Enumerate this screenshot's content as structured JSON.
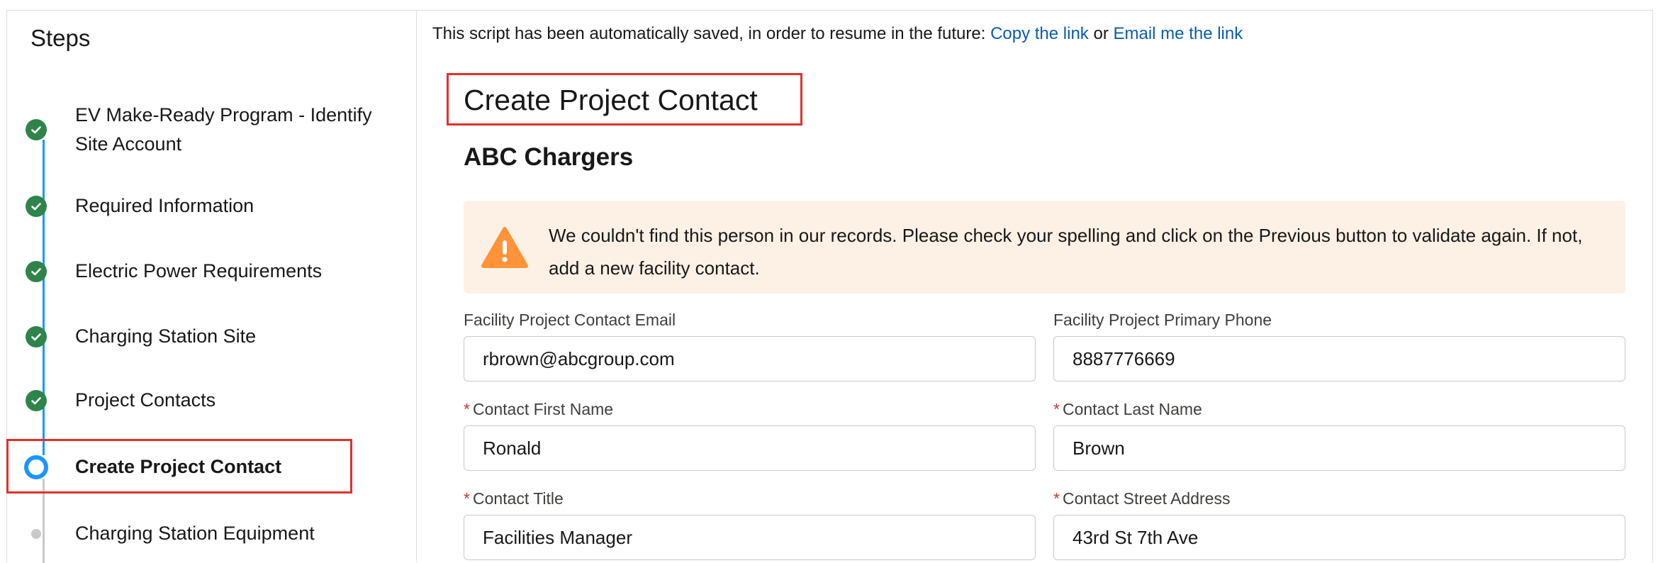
{
  "sidebar": {
    "title": "Steps",
    "steps": [
      {
        "label": "EV Make-Ready Program - Identify Site Account",
        "status": "complete"
      },
      {
        "label": "Required Information",
        "status": "complete"
      },
      {
        "label": "Electric Power Requirements",
        "status": "complete"
      },
      {
        "label": "Charging Station Site",
        "status": "complete"
      },
      {
        "label": "Project Contacts",
        "status": "complete"
      },
      {
        "label": "Create Project Contact",
        "status": "current"
      },
      {
        "label": "Charging Station Equipment",
        "status": "upcoming"
      }
    ]
  },
  "autosave": {
    "message": "This script has been automatically saved, in order to resume in the future: ",
    "copy_link": "Copy the link",
    "separator": " or ",
    "email_link": "Email me the link"
  },
  "form": {
    "title": "Create Project Contact",
    "org_name": "ABC Chargers",
    "warning": "We couldn't find this person in our records. Please check your spelling and click on the Previous button to validate again. If not, add a new facility contact.",
    "fields": {
      "email": {
        "label": "Facility Project Contact Email",
        "value": "rbrown@abcgroup.com",
        "required": false
      },
      "phone": {
        "label": "Facility Project Primary Phone",
        "value": "8887776669",
        "required": false
      },
      "first_name": {
        "label": "Contact First Name",
        "value": "Ronald",
        "required": true
      },
      "last_name": {
        "label": "Contact Last Name",
        "value": "Brown",
        "required": true
      },
      "title": {
        "label": "Contact Title",
        "value": "Facilities Manager",
        "required": true
      },
      "street": {
        "label": "Contact Street Address",
        "value": "43rd St 7th Ave",
        "required": true
      }
    },
    "required_marker": "*"
  },
  "colors": {
    "complete": "#2e844a",
    "current": "#1b96ff",
    "upcoming": "#c9c9c9",
    "warning_bg": "#fdf1e6",
    "warning_icon": "#fe9339",
    "highlight": "#e0312d",
    "link": "#0b5cab"
  }
}
